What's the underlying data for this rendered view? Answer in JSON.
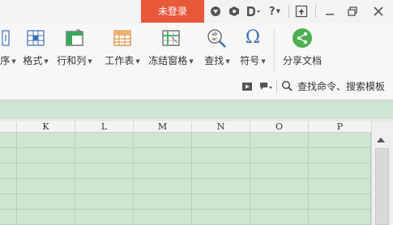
{
  "titlebar": {
    "login_label": "未登录",
    "help_label": "?",
    "icons": [
      "pin-icon",
      "skin-icon",
      "d-menu-icon",
      "help-icon",
      "collapse-ribbon-icon",
      "minimize-icon",
      "restore-icon",
      "close-icon"
    ]
  },
  "ribbon": {
    "items": [
      {
        "label": "序",
        "icon": "sort-icon"
      },
      {
        "label": "格式",
        "icon": "format-icon"
      },
      {
        "label": "行和列",
        "icon": "rows-cols-icon"
      },
      {
        "label": "工作表",
        "icon": "worksheet-icon"
      },
      {
        "label": "冻结窗格",
        "icon": "freeze-panes-icon"
      },
      {
        "label": "查找",
        "icon": "find-icon"
      },
      {
        "label": "符号",
        "icon": "symbol-icon"
      },
      {
        "label": "分享文档",
        "icon": "share-icon"
      }
    ],
    "search_label": "查找命令、搜索模板",
    "find_icon_text": "ab\nac",
    "symbol_glyph": "Ω"
  },
  "sheet": {
    "columns": [
      "K",
      "L",
      "M",
      "N",
      "O",
      "P"
    ]
  },
  "colors": {
    "login_bg": "#e8593a",
    "grid_bg": "#cde6cf",
    "grid_line": "#b5d1b8",
    "share_green": "#4caf50"
  }
}
